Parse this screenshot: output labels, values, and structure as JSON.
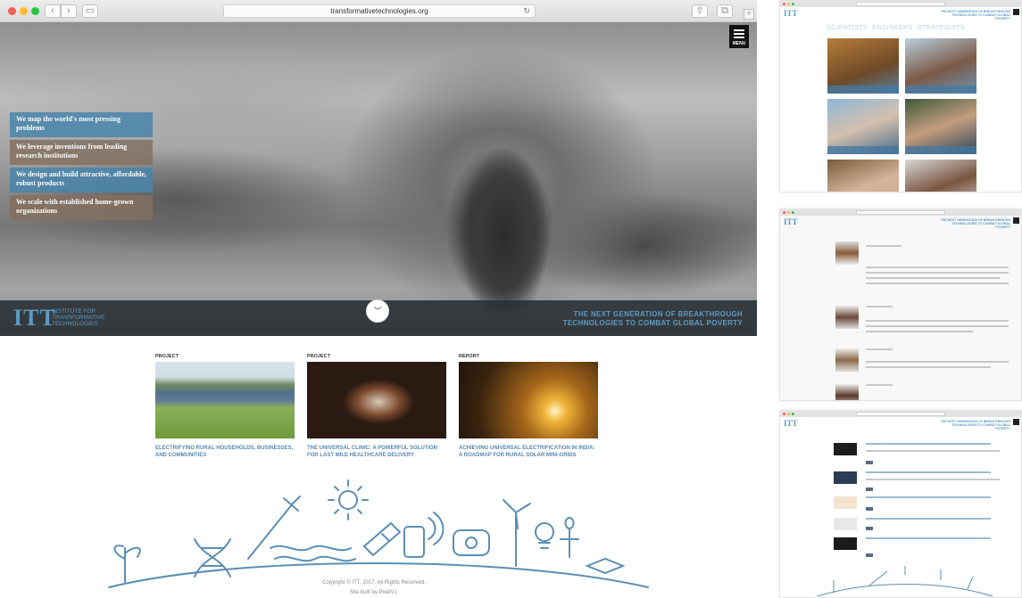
{
  "browser": {
    "url": "transformativetechnologies.org"
  },
  "hero": {
    "menu_label": "MENU",
    "pillars": [
      {
        "text": "We map the world's most pressing problems",
        "color": "#4a85aa"
      },
      {
        "text": "We leverage inventions from leading research institutions",
        "color": "#847060"
      },
      {
        "text": "We design and build attractive, affordable, robust products",
        "color": "#4a85aa"
      },
      {
        "text": "We scale with established home-grown organizations",
        "color": "#847060"
      }
    ],
    "logo": "ITT",
    "logo_text": "INSTITUTE FOR TRANSFORMATIVE TECHNOLOGIES",
    "tagline": "THE NEXT GENERATION OF BREAKTHROUGH TECHNOLOGIES TO COMBAT GLOBAL POVERTY",
    "scroll_icon": "chevron-down-icon"
  },
  "cards": [
    {
      "type": "PROJECT",
      "title": "ELECTRIFYING RURAL HOUSEHOLDS, BUSINESSES, AND COMMUNITIES"
    },
    {
      "type": "PROJECT",
      "title": "THE UNIVERSAL CLINIC: A POWERFUL SOLUTION FOR LAST MILE HEALTHCARE DELIVERY"
    },
    {
      "type": "REPORT",
      "title": "ACHIEVING UNIVERSAL ELECTRIFICATION IN INDIA: A ROADMAP FOR RURAL SOLAR MINI-GRIDS"
    }
  ],
  "footer": {
    "copyright": "Copyright © ITT, 2017. All Rights Reserved.",
    "built_by": "Site built by PixelVJ."
  },
  "thumbnails": {
    "logo": "ITT",
    "tagline": "THE NEXT GENERATION OF BREAKTHROUGH TECHNOLOGIES TO COMBAT GLOBAL POVERTY",
    "team_heading": "SCIENTISTS. ENGINEERS. STRATEGISTS."
  },
  "colors": {
    "accent": "#5c9ac4",
    "link": "#5888b0"
  }
}
